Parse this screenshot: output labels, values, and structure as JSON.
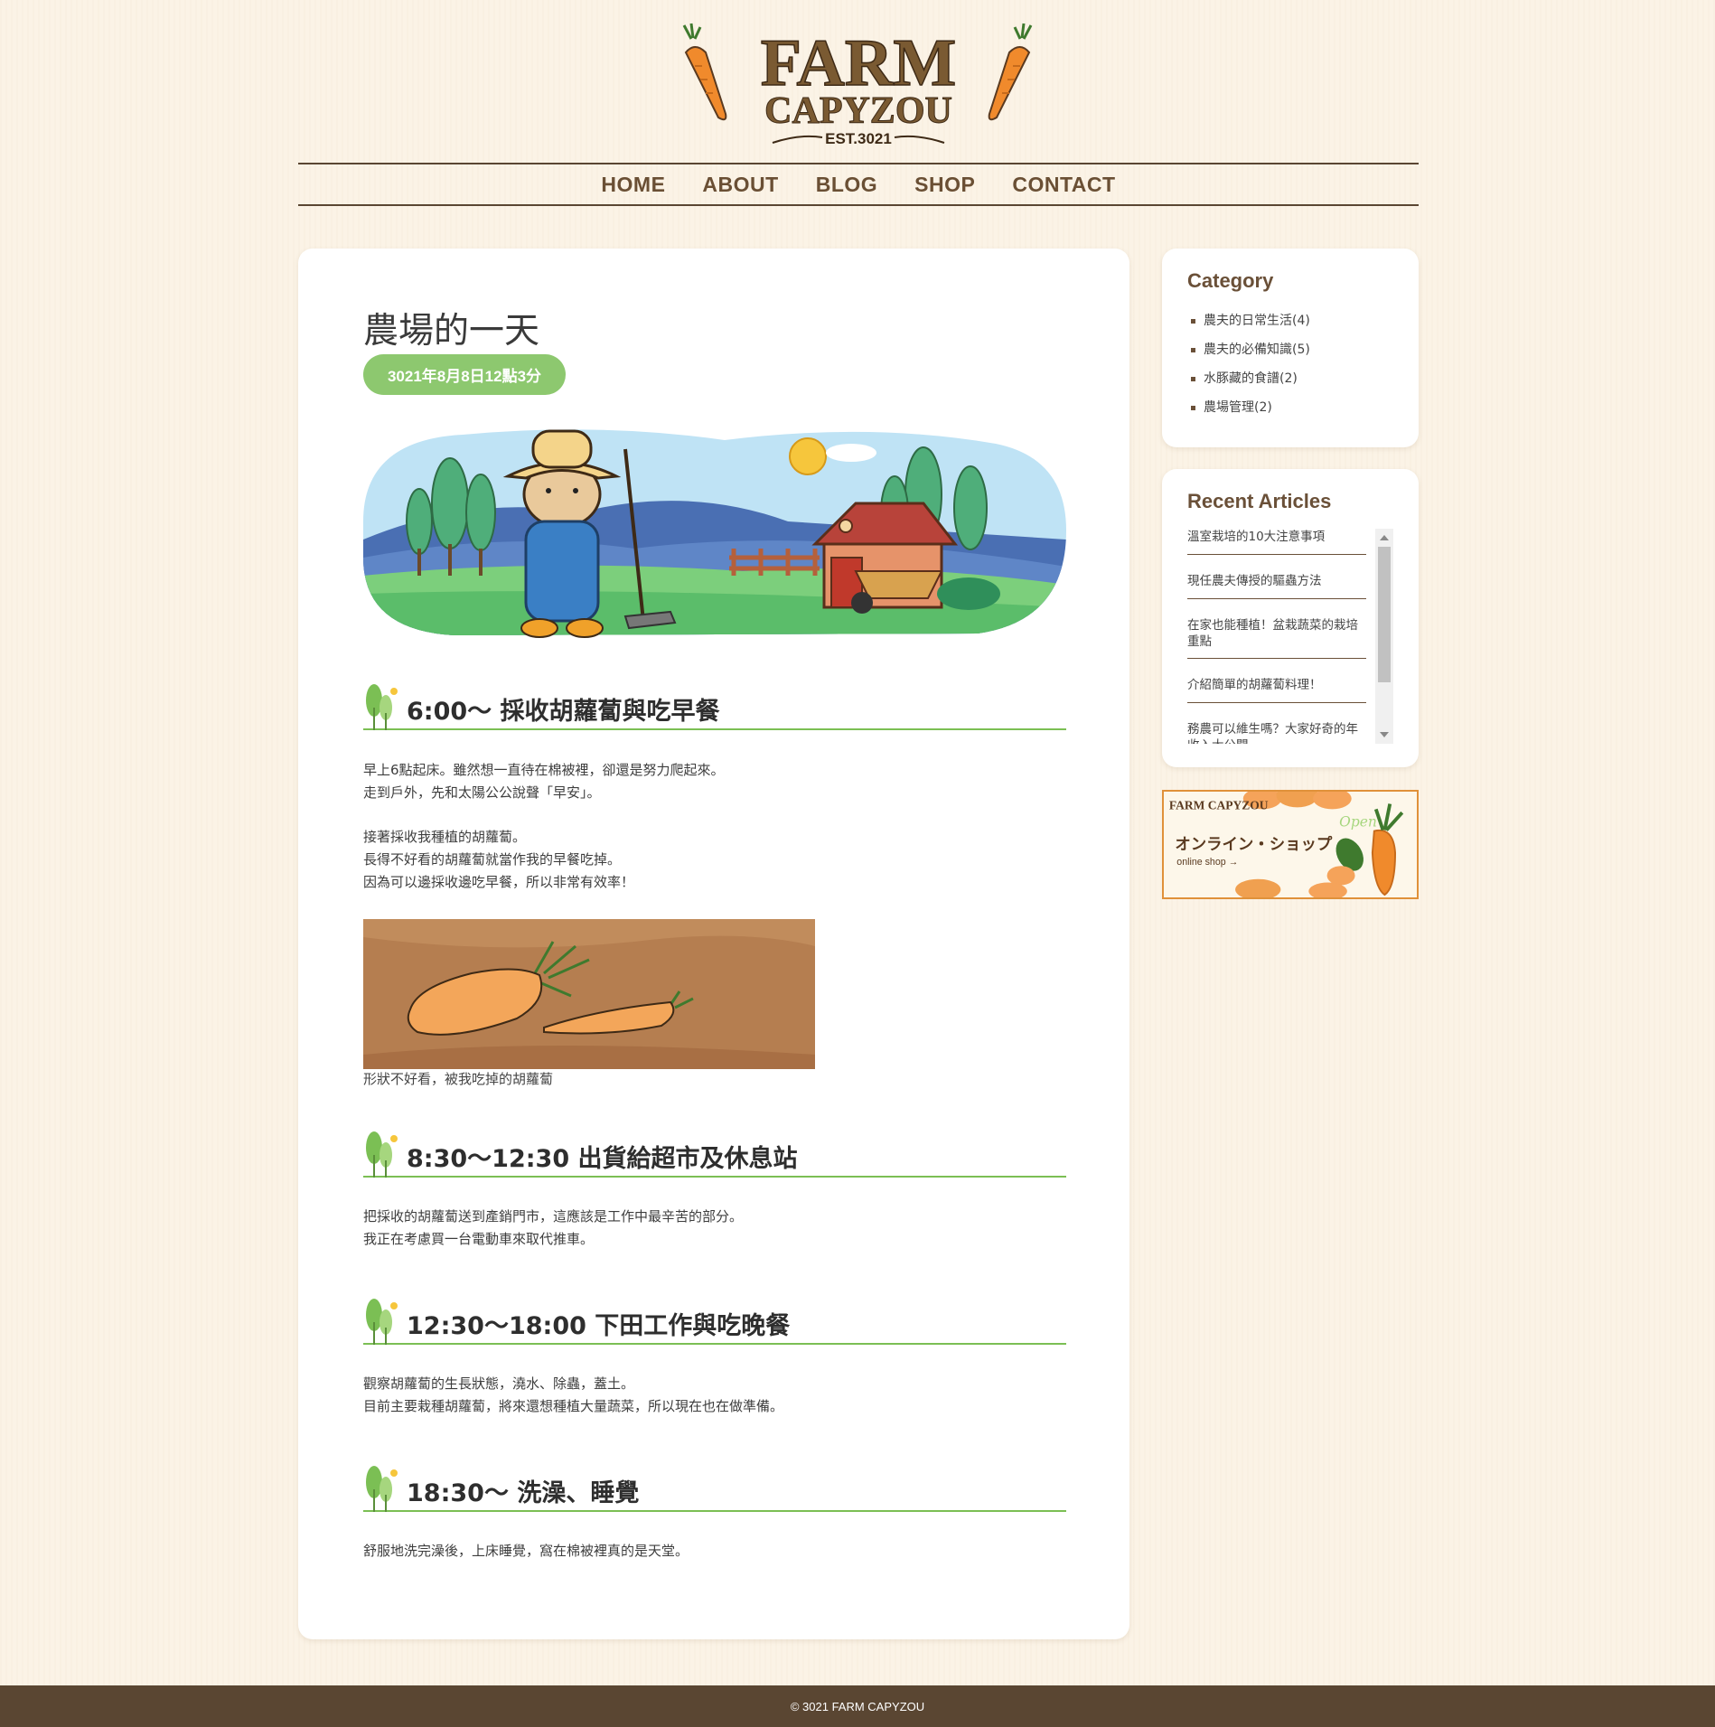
{
  "site": {
    "logo": {
      "line1": "FARM",
      "line2": "CAPYZOU",
      "est": "EST.3021"
    }
  },
  "nav": {
    "items": [
      {
        "label": "HOME"
      },
      {
        "label": "ABOUT"
      },
      {
        "label": "BLOG"
      },
      {
        "label": "SHOP"
      },
      {
        "label": "CONTACT"
      }
    ]
  },
  "article": {
    "title": "農場的一天",
    "date": "3021年8月8日12點3分",
    "sections": [
      {
        "heading": "6:00～ 採收胡蘿蔔與吃早餐",
        "paragraphs": [
          [
            "早上6點起床。雖然想一直待在棉被裡，卻還是努力爬起來。",
            "走到戶外，先和太陽公公說聲「早安」。"
          ],
          [
            "接著採收我種植的胡蘿蔔。",
            "長得不好看的胡蘿蔔就當作我的早餐吃掉。",
            "因為可以邊採收邊吃早餐，所以非常有效率！"
          ]
        ],
        "image_caption": "形狀不好看，被我吃掉的胡蘿蔔"
      },
      {
        "heading": "8:30～12:30 出貨給超市及休息站",
        "paragraphs": [
          [
            "把採收的胡蘿蔔送到產銷門市，這應該是工作中最辛苦的部分。",
            "我正在考慮買一台電動車來取代推車。"
          ]
        ]
      },
      {
        "heading": "12:30～18:00 下田工作與吃晚餐",
        "paragraphs": [
          [
            "觀察胡蘿蔔的生長狀態，澆水、除蟲，蓋土。",
            "目前主要栽種胡蘿蔔，將來還想種植大量蔬菜，所以現在也在做準備。"
          ]
        ]
      },
      {
        "heading": "18:30～ 洗澡、睡覺",
        "paragraphs": [
          [
            "舒服地洗完澡後，上床睡覺，窩在棉被裡真的是天堂。"
          ]
        ]
      }
    ]
  },
  "sidebar": {
    "category": {
      "title": "Category",
      "items": [
        {
          "label": "農夫的日常生活(4)"
        },
        {
          "label": "農夫的必備知識(5)"
        },
        {
          "label": "水豚藏的食譜(2)"
        },
        {
          "label": "農場管理(2)"
        }
      ]
    },
    "recent": {
      "title": "Recent Articles",
      "items": [
        {
          "label": "溫室栽培的10大注意事項"
        },
        {
          "label": "現任農夫傳授的驅蟲方法"
        },
        {
          "label": "在家也能種植！盆栽蔬菜的栽培重點"
        },
        {
          "label": "介紹簡單的胡蘿蔔料理！"
        },
        {
          "label": "務農可以維生嗎？大家好奇的年收入大公開"
        }
      ]
    },
    "shop_banner": {
      "logo_text": "FARM CAPYZOU",
      "title": "オンライン・ショップ",
      "subtitle": "online shop →",
      "script": "Open"
    }
  },
  "footer": {
    "copyright": "© 3021 FARM CAPYZOU"
  },
  "colors": {
    "background": "#fbf3e6",
    "brown": "#5a4632",
    "nav_text": "#6a4f34",
    "green_accent": "#8dc86f",
    "underline_green": "#7bbf54",
    "carrot_orange": "#f08a2c"
  }
}
